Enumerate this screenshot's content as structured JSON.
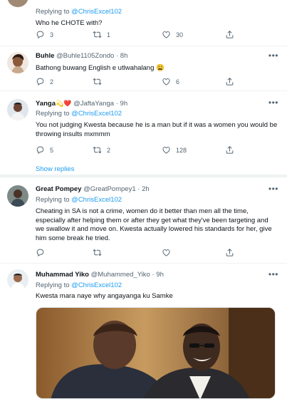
{
  "tweets": [
    {
      "reply_prefix": "Replying to ",
      "reply_to": "@ChrisExcel102",
      "text": "Who he CHOTE with?",
      "replies": "3",
      "retweets": "1",
      "likes": "30"
    },
    {
      "name": "Buhle",
      "handle": "@Buhle1105Zondo",
      "dot": "·",
      "time": "8h",
      "text": "Bathong buwang English e utlwahalang 😩",
      "replies": "2",
      "retweets": "",
      "likes": "6"
    },
    {
      "name": "Yanga",
      "name_emoji": "💫❤️",
      "handle": "@JaftaYanga",
      "dot": "·",
      "time": "9h",
      "reply_prefix": "Replying to ",
      "reply_to": "@ChrisExcel102",
      "text": "You not judging Kwesta because he is a man but if it was a women you would be throwing insults mxmmm",
      "replies": "5",
      "retweets": "2",
      "likes": "128",
      "show_replies": "Show replies"
    },
    {
      "name": "Great Pompey",
      "handle": "@GreatPompey1",
      "dot": "·",
      "time": "2h",
      "reply_prefix": "Replying to ",
      "reply_to": "@ChrisExcel102",
      "text": "Cheating in SA is not a crime, women do it better than men all the time, especially after helping them or after they get what they've been targeting and we swallow it and move on. Kwesta actually lowered his standards for her, give him some break he tried.",
      "replies": "",
      "retweets": "",
      "likes": ""
    },
    {
      "name": "Muhammad Yiko",
      "handle": "@Muhammed_Yiko",
      "dot": "·",
      "time": "9h",
      "reply_prefix": "Replying to ",
      "reply_to": "@ChrisExcel102",
      "text": "Kwesta mara naye why angayanga ku Samke"
    }
  ],
  "icons": {
    "reply": "reply-icon",
    "retweet": "retweet-icon",
    "like": "heart-icon",
    "share": "share-icon",
    "more": "more-icon"
  },
  "colors": {
    "link": "#1d9bf0",
    "secondary_text": "#536471",
    "divider": "#eff3f4"
  }
}
